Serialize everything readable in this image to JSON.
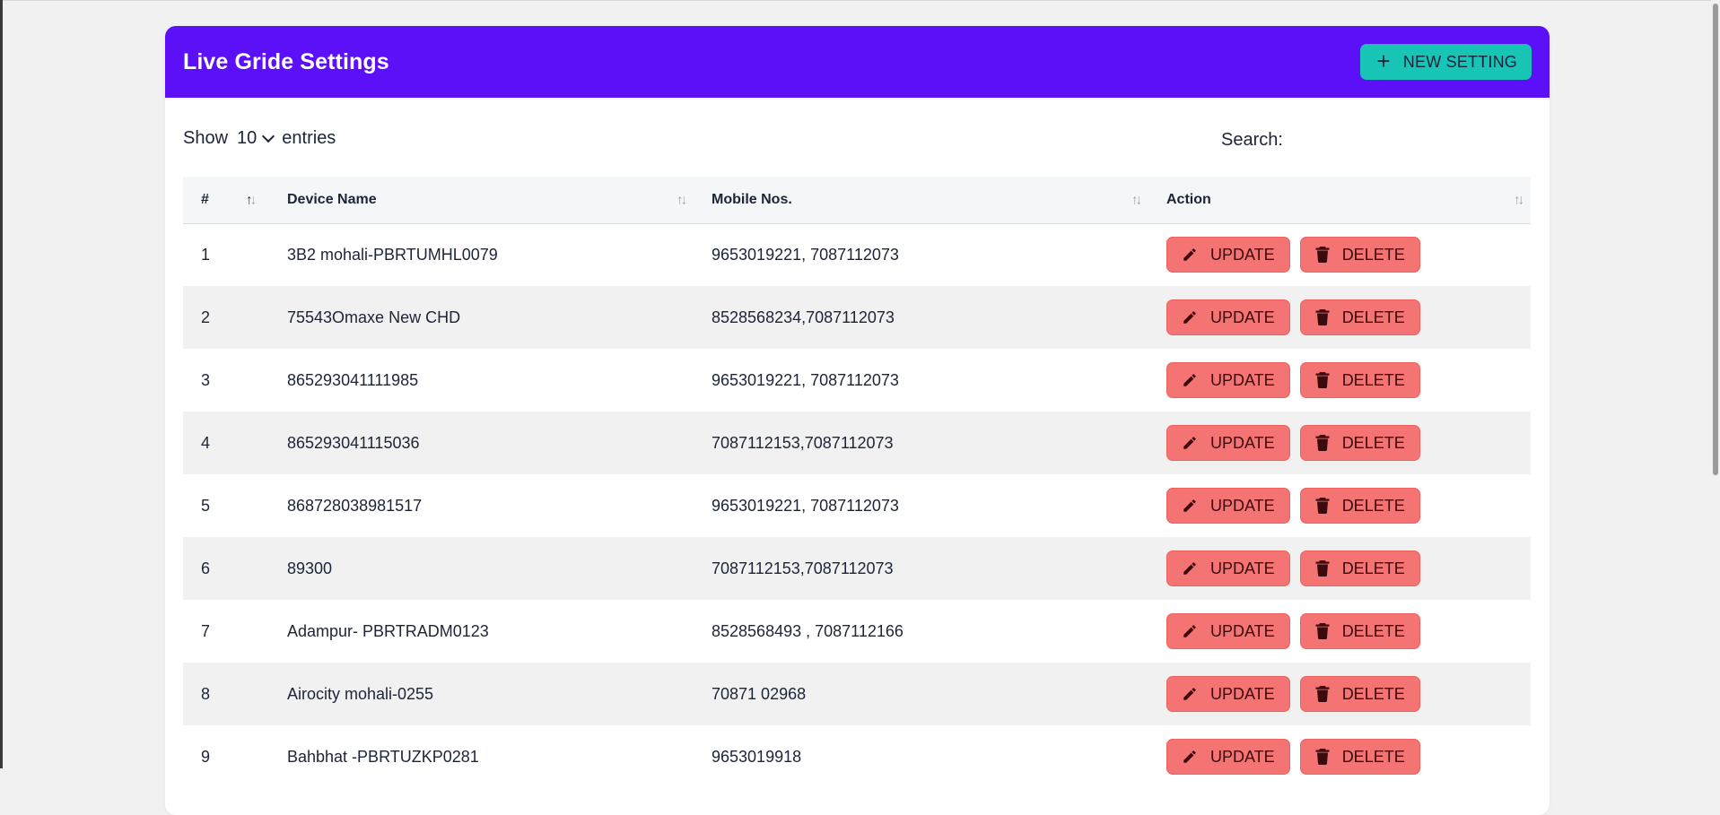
{
  "header": {
    "title": "Live Gride Settings",
    "new_button_label": "NEW SETTING"
  },
  "controls": {
    "show_label": "Show",
    "entries_value": "10",
    "entries_label": "entries",
    "search_label": "Search:"
  },
  "table": {
    "columns": [
      "#",
      "Device Name",
      "Mobile Nos.",
      "Action"
    ],
    "update_label": "UPDATE",
    "delete_label": "DELETE",
    "rows": [
      {
        "num": "1",
        "device": "3B2 mohali-PBRTUMHL0079",
        "mobile": "9653019221, 7087112073"
      },
      {
        "num": "2",
        "device": "75543Omaxe New CHD",
        "mobile": "8528568234,7087112073"
      },
      {
        "num": "3",
        "device": "865293041111985",
        "mobile": "9653019221, 7087112073"
      },
      {
        "num": "4",
        "device": "865293041115036",
        "mobile": "7087112153,7087112073"
      },
      {
        "num": "5",
        "device": "868728038981517",
        "mobile": "9653019221, 7087112073"
      },
      {
        "num": "6",
        "device": "89300",
        "mobile": "7087112153,7087112073"
      },
      {
        "num": "7",
        "device": "Adampur- PBRTRADM0123",
        "mobile": "8528568493 , 7087112166"
      },
      {
        "num": "8",
        "device": "Airocity mohali-0255",
        "mobile": "70871 02968"
      },
      {
        "num": "9",
        "device": "Bahbhat -PBRTUZKP0281",
        "mobile": "9653019918"
      }
    ]
  },
  "icons": {
    "new": "plus-icon",
    "update": "pencil-icon",
    "delete": "trash-icon",
    "sort": "sort-arrows-icon",
    "entries": "chevron-down-icon"
  },
  "colors": {
    "header_bg": "#5b10f7",
    "new_button_bg": "#18c4b6",
    "action_button_bg": "#f47373"
  }
}
